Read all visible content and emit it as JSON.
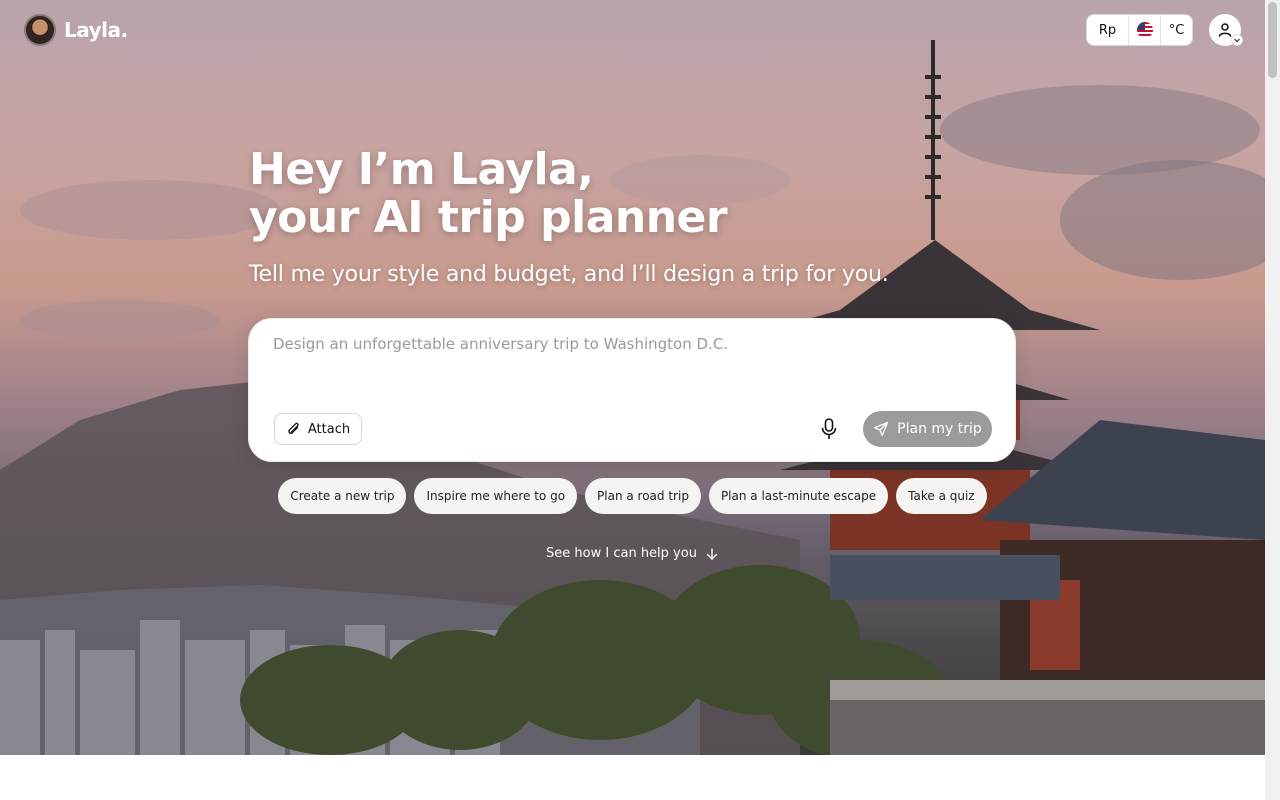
{
  "header": {
    "brand": "Layla.",
    "currency": "Rp",
    "temperature_unit": "°C",
    "flag_icon": "us-flag-icon",
    "user_icon": "user-icon"
  },
  "hero": {
    "headline_line1": "Hey I’m Layla,",
    "headline_line2": "your AI trip planner",
    "subtitle": "Tell me your style and budget, and I’ll design a trip for you."
  },
  "prompt": {
    "placeholder": "Design an unforgettable anniversary trip to Washington D.C.",
    "value": "",
    "attach_label": "Attach",
    "submit_label": "Plan my trip"
  },
  "suggestions": [
    "Create a new trip",
    "Inspire me where to go",
    "Plan a road trip",
    "Plan a last-minute escape",
    "Take a quiz"
  ],
  "see_how": {
    "label": "See how I can help you"
  },
  "colors": {
    "submit_button": "#9b9b9b",
    "chip_bg": "#f6f4f2"
  }
}
